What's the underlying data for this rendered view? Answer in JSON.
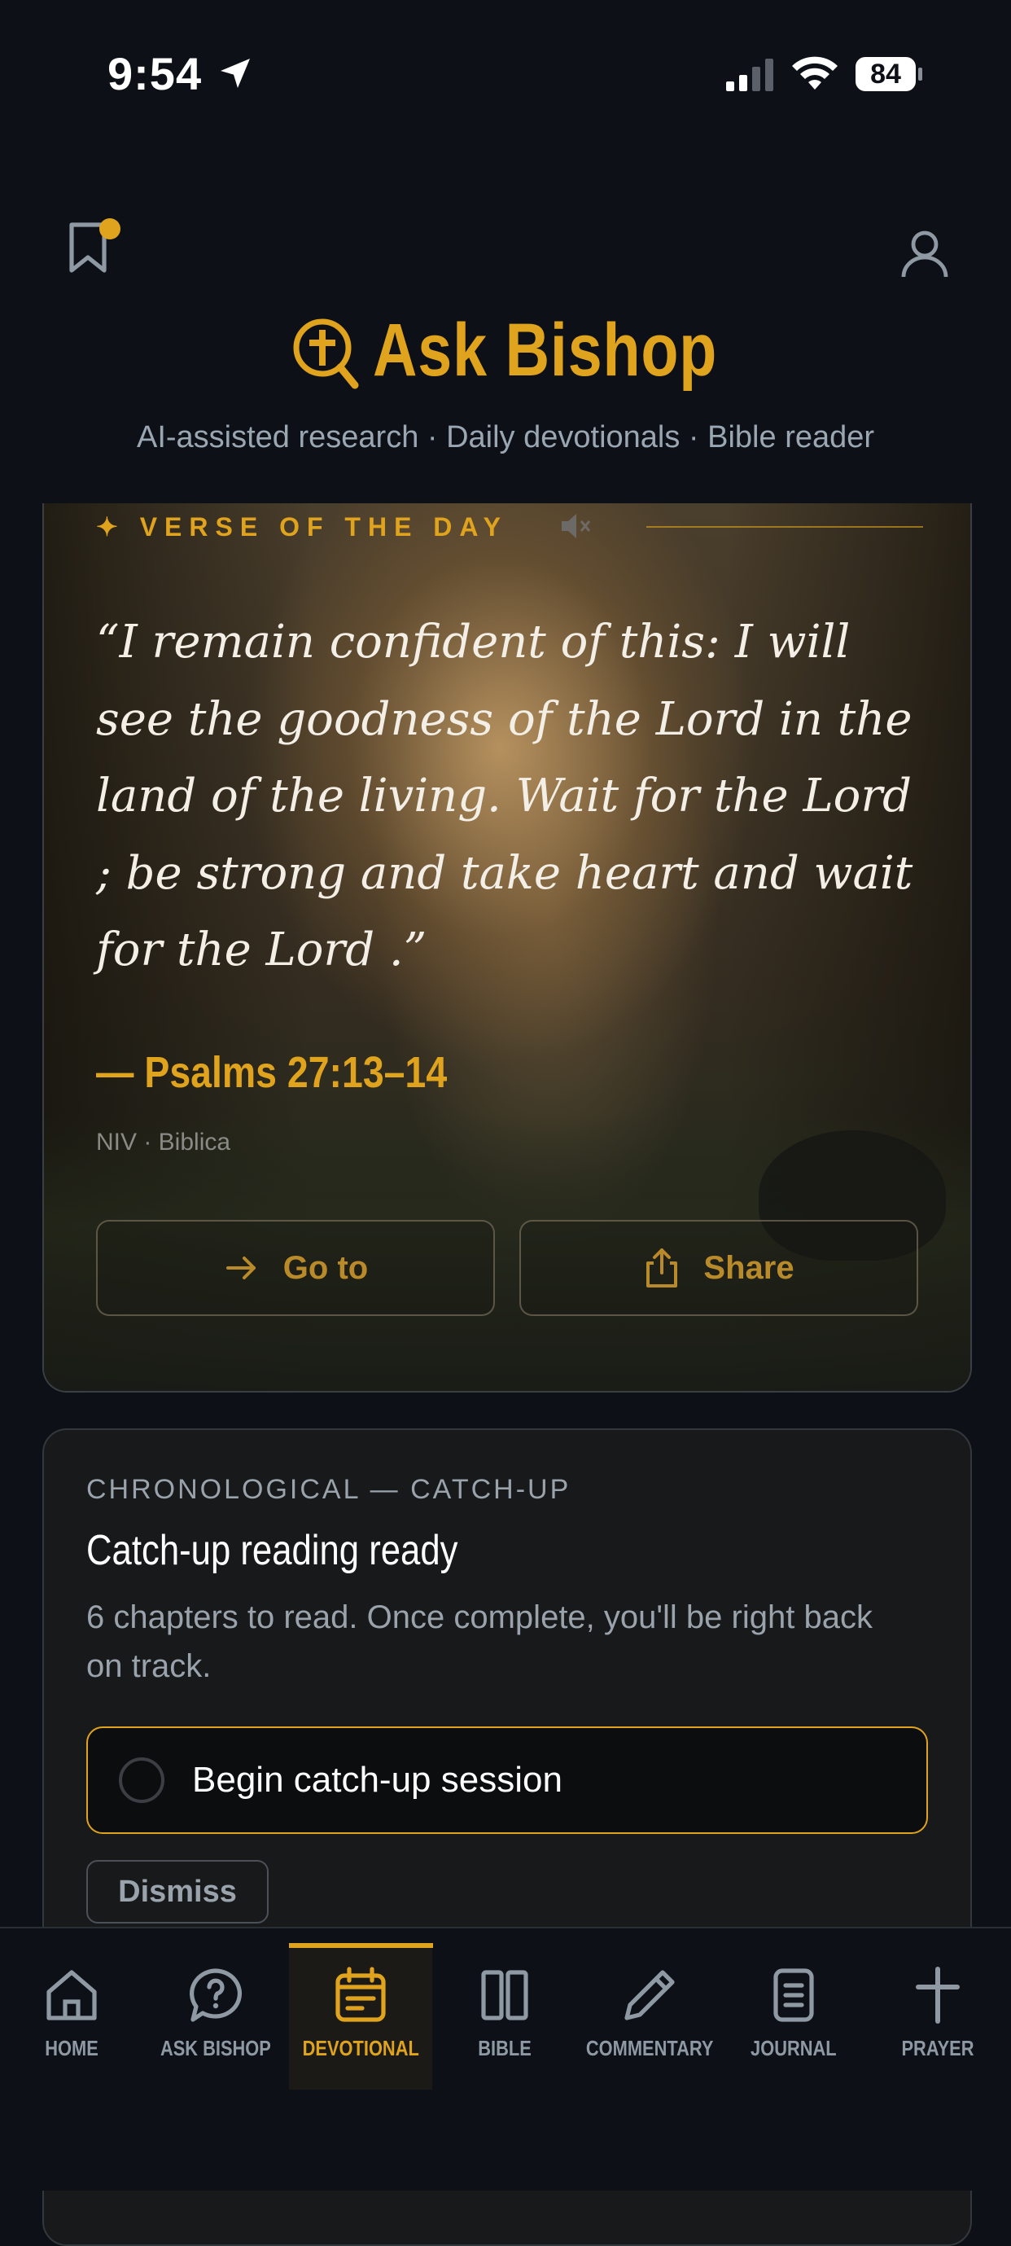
{
  "status_bar": {
    "time": "9:54",
    "battery": "84"
  },
  "header": {
    "title": "Ask Bishop",
    "tagline": "AI-assisted research · Daily devotionals · Bible reader"
  },
  "verse_card": {
    "label": "✦ VERSE OF THE DAY",
    "verse": "“I remain confident of this: I will see the goodness of the Lord in the land of the living. Wait for the Lord ; be strong and take heart and wait for the Lord .”",
    "reference": "— Psalms 27:13–14",
    "version": "NIV · Biblica",
    "goto_label": "Go to",
    "share_label": "Share"
  },
  "catchup_card": {
    "eyebrow": "CHRONOLOGICAL — CATCH-UP",
    "title": "Catch-up reading ready",
    "description": "6 chapters to read. Once complete, you'll be right back on track.",
    "begin_label": "Begin catch-up session",
    "dismiss_label": "Dismiss"
  },
  "bottom_nav": {
    "active": "DEVOTIONAL",
    "items": [
      {
        "label": "HOME",
        "icon": "home-icon"
      },
      {
        "label": "ASK BISHOP",
        "icon": "chat-question-icon"
      },
      {
        "label": "DEVOTIONAL",
        "icon": "calendar-icon"
      },
      {
        "label": "BIBLE",
        "icon": "book-icon"
      },
      {
        "label": "COMMENTARY",
        "icon": "pen-icon"
      },
      {
        "label": "JOURNAL",
        "icon": "journal-icon"
      },
      {
        "label": "PRAYER",
        "icon": "cross-icon"
      }
    ]
  },
  "colors": {
    "accent": "#e0a31e",
    "background": "#0d1117",
    "muted_text": "#9aa3ab"
  }
}
